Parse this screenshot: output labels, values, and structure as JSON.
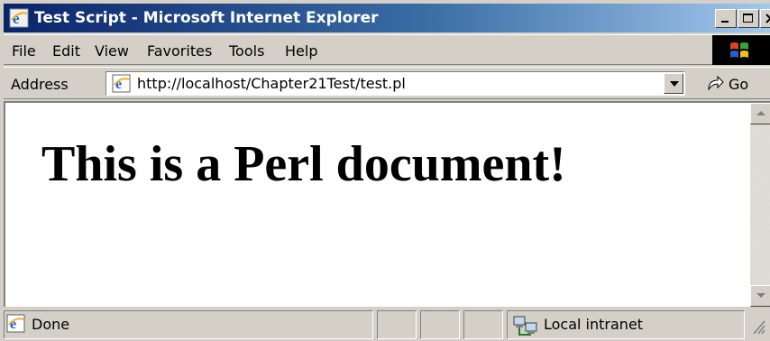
{
  "window": {
    "title": "Test Script - Microsoft Internet Explorer",
    "icon": "ie-icon"
  },
  "title_buttons": [
    "minimize-icon",
    "maximize-icon",
    "close-icon"
  ],
  "menu": {
    "items": [
      {
        "label": "File"
      },
      {
        "label": "Edit"
      },
      {
        "label": "View"
      },
      {
        "label": "Favorites"
      },
      {
        "label": "Tools"
      },
      {
        "label": "Help"
      }
    ],
    "throbber_icon": "windows-logo-icon"
  },
  "address_bar": {
    "label": "Address",
    "url": "http://localhost/Chapter21Test/test.pl",
    "page_icon": "ie-page-icon",
    "dropdown_icon": "chevron-down-icon",
    "go_label": "Go",
    "go_icon": "go-arrow-icon"
  },
  "content": {
    "heading": "This is a Perl document!"
  },
  "scrollbar": {
    "up_icon": "arrow-up-icon",
    "down_icon": "arrow-down-icon"
  },
  "status": {
    "text": "Done",
    "icon": "ie-page-icon",
    "zone_text": "Local intranet",
    "zone_icon": "local-intranet-icon",
    "grip_icon": "resize-grip-icon"
  },
  "colors": {
    "title_start": "#0a246a",
    "title_end": "#a6caf0",
    "chrome": "#d4d0c8"
  }
}
